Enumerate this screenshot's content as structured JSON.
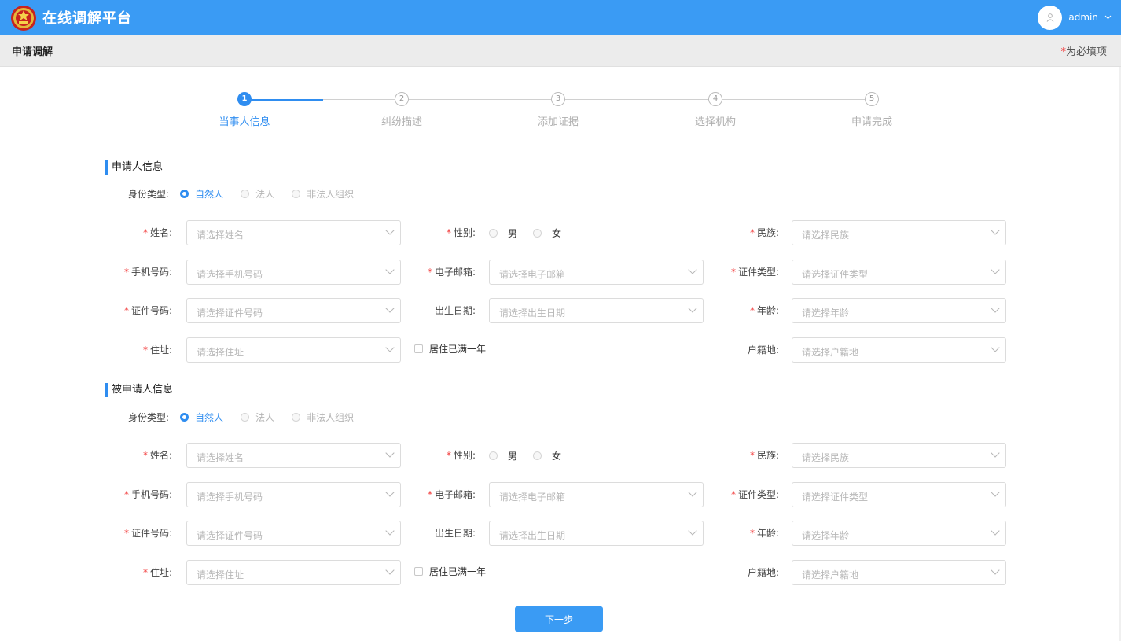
{
  "header": {
    "app_title": "在线调解平台",
    "username": "admin",
    "logo_icon": "court-emblem-icon",
    "user_icon": "user-icon",
    "accent_color": "#3a9bf4"
  },
  "subheader": {
    "title": "申请调解",
    "required_star": "*",
    "required_text": "为必填项"
  },
  "steps": [
    {
      "num": "1",
      "label": "当事人信息",
      "active": true
    },
    {
      "num": "2",
      "label": "纠纷描述",
      "active": false
    },
    {
      "num": "3",
      "label": "添加证据",
      "active": false
    },
    {
      "num": "4",
      "label": "选择机构",
      "active": false
    },
    {
      "num": "5",
      "label": "申请完成",
      "active": false
    }
  ],
  "applicant": {
    "title": "申请人信息",
    "id_type_label": "身份类型:",
    "id_options": [
      "自然人",
      "法人",
      "非法人组织"
    ],
    "id_selected": "自然人",
    "name_label": "姓名:",
    "name_placeholder": "请选择姓名",
    "gender_label": "性别:",
    "gender_male": "男",
    "gender_female": "女",
    "ethnicity_label": "民族:",
    "ethnicity_placeholder": "请选择民族",
    "phone_label": "手机号码:",
    "phone_placeholder": "请选择手机号码",
    "email_label": "电子邮箱:",
    "email_placeholder": "请选择电子邮箱",
    "idtype_label": "证件类型:",
    "idtype_placeholder": "请选择证件类型",
    "idnum_label": "证件号码:",
    "idnum_placeholder": "请选择证件号码",
    "birth_label": "出生日期:",
    "birth_placeholder": "请选择出生日期",
    "age_label": "年龄:",
    "age_placeholder": "请选择年龄",
    "address_label": "住址:",
    "address_placeholder": "请选择住址",
    "residence_checkbox": "居住已满一年",
    "hukou_label": "户籍地:",
    "hukou_placeholder": "请选择户籍地"
  },
  "respondent": {
    "title": "被申请人信息",
    "id_type_label": "身份类型:",
    "id_options": [
      "自然人",
      "法人",
      "非法人组织"
    ],
    "id_selected": "自然人",
    "name_label": "姓名:",
    "name_placeholder": "请选择姓名",
    "gender_label": "性别:",
    "gender_male": "男",
    "gender_female": "女",
    "ethnicity_label": "民族:",
    "ethnicity_placeholder": "请选择民族",
    "phone_label": "手机号码:",
    "phone_placeholder": "请选择手机号码",
    "email_label": "电子邮箱:",
    "email_placeholder": "请选择电子邮箱",
    "idtype_label": "证件类型:",
    "idtype_placeholder": "请选择证件类型",
    "idnum_label": "证件号码:",
    "idnum_placeholder": "请选择证件号码",
    "birth_label": "出生日期:",
    "birth_placeholder": "请选择出生日期",
    "age_label": "年龄:",
    "age_placeholder": "请选择年龄",
    "address_label": "住址:",
    "address_placeholder": "请选择住址",
    "residence_checkbox": "居住已满一年",
    "hukou_label": "户籍地:",
    "hukou_placeholder": "请选择户籍地"
  },
  "actions": {
    "next_label": "下一步"
  },
  "required_mark": "*"
}
